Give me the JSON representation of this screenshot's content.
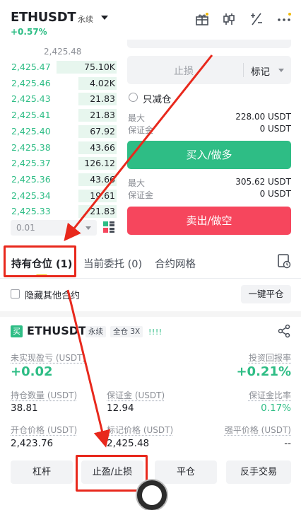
{
  "header": {
    "symbol": "ETHUSDT",
    "contract_type": "永续",
    "change": "+0.57%",
    "icons": [
      "gift-icon",
      "candlestick-icon",
      "plus-minus-icon",
      "more-icon"
    ]
  },
  "order_book": {
    "mid_price": "2,425.48",
    "rows": [
      {
        "price": "2,425.47",
        "qty": "75.10K",
        "depth": 0.55
      },
      {
        "price": "2,425.46",
        "qty": "4.02K",
        "depth": 0.35
      },
      {
        "price": "2,425.43",
        "qty": "21.83",
        "depth": 0.35
      },
      {
        "price": "2,425.41",
        "qty": "21.83",
        "depth": 0.35
      },
      {
        "price": "2,425.40",
        "qty": "67.92",
        "depth": 0.35
      },
      {
        "price": "2,425.38",
        "qty": "43.66",
        "depth": 0.35
      },
      {
        "price": "2,425.37",
        "qty": "126.12",
        "depth": 0.35
      },
      {
        "price": "2,425.36",
        "qty": "43.66",
        "depth": 0.35
      },
      {
        "price": "2,425.34",
        "qty": "19.61",
        "depth": 0.35
      },
      {
        "price": "2,425.33",
        "qty": "21.83",
        "depth": 0.35
      }
    ],
    "precision": "0.01"
  },
  "order_form": {
    "stop_loss_placeholder": "止损",
    "mark_label": "标记",
    "reduce_only": "只减仓",
    "buy_max_label": "最大",
    "buy_max_value": "228.00 USDT",
    "buy_margin_label": "保证金",
    "buy_margin_value": "0 USDT",
    "buy_button": "买入/做多",
    "sell_max_label": "最大",
    "sell_max_value": "305.62 USDT",
    "sell_margin_label": "保证金",
    "sell_margin_value": "0 USDT",
    "sell_button": "卖出/做空"
  },
  "tabs": {
    "positions": "持有仓位 (1)",
    "open_orders": "当前委托 (0)",
    "grid": "合约网格"
  },
  "filter": {
    "hide_others": "隐藏其他合约",
    "close_all": "一键平仓"
  },
  "position": {
    "side_badge": "买",
    "symbol": "ETHUSDT",
    "type": "永续",
    "margin_mode": "全仓 3X",
    "signal": "!!!!",
    "unrealized_pnl_label": "未实现盈亏 (USDT)",
    "unrealized_pnl": "+0.02",
    "roi_label": "投资回报率",
    "roi": "+0.21%",
    "size_label": "持仓数量 (USDT)",
    "size": "38.81",
    "margin_label": "保证金 (USDT)",
    "margin": "12.94",
    "margin_ratio_label": "保证金比率",
    "margin_ratio": "0.17%",
    "entry_label": "开仓价格 (USDT)",
    "entry": "2,423.76",
    "mark_label": "标记价格 (USDT)",
    "mark": "2,425.48",
    "liq_label": "强平价格 (USDT)",
    "liq": "--",
    "actions": {
      "leverage": "杠杆",
      "tpsl": "止盈/止损",
      "close": "平仓",
      "reverse": "反手交易"
    }
  },
  "colors": {
    "green": "#2ebd85",
    "red": "#f6465d",
    "accent": "#f0b90b",
    "annotation": "#e8281c"
  }
}
